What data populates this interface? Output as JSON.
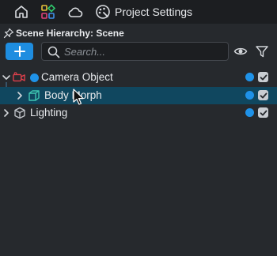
{
  "topbar": {
    "icons": [
      "home-icon",
      "apps-grid-icon",
      "cloud-icon",
      "palette-settings-icon"
    ],
    "project_settings_label": "Project Settings"
  },
  "panel": {
    "title": "Scene Hierarchy: Scene",
    "pin_icon": "pin-icon"
  },
  "toolbar": {
    "add_label": "+",
    "search_placeholder": "Search...",
    "search_value": "",
    "icons": [
      "search-icon",
      "eye-icon",
      "filter-icon"
    ]
  },
  "tree": {
    "rows": [
      {
        "name": "Camera Object",
        "icon": "camera-icon",
        "expanded": true,
        "selected": false,
        "depth": 0
      },
      {
        "name": "Body Morph",
        "icon": "cube-icon",
        "expanded": false,
        "selected": true,
        "depth": 1
      },
      {
        "name": "Lighting",
        "icon": "light-cube-icon",
        "expanded": false,
        "selected": false,
        "depth": 0
      }
    ]
  },
  "colors": {
    "background": "#26292d",
    "topbar": "#1c1e21",
    "accent_blue": "#1e8de0",
    "selection": "#10475f",
    "camera_red": "#e0404c",
    "cube_teal": "#3fc7b3"
  }
}
